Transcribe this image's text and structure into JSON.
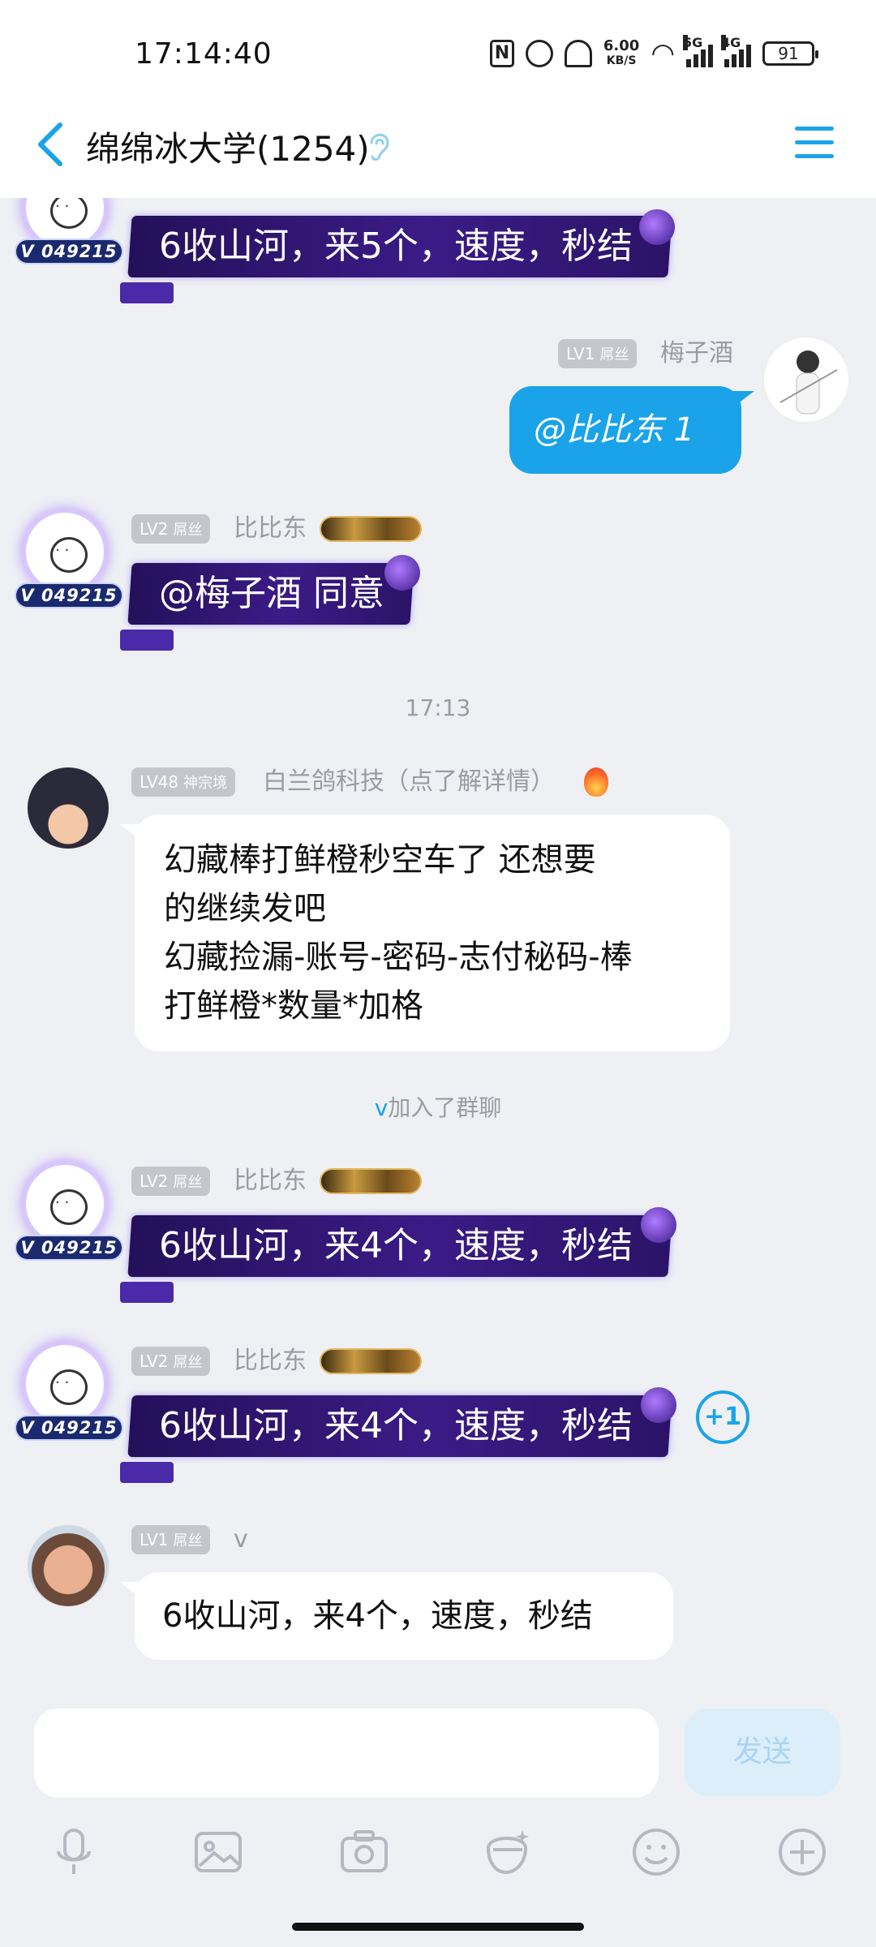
{
  "status": {
    "time": "17:14:40",
    "speed_top": "6.00",
    "speed_unit": "KB/S",
    "net1": "5G",
    "net2": "4G",
    "battery": "91"
  },
  "header": {
    "title": "绵绵冰大学(1254)"
  },
  "messages": {
    "m1": {
      "vbadge": "V 049215",
      "text": "6收山河，来5个，速度，秒结"
    },
    "m2": {
      "level": "LV1",
      "rank": "屌丝",
      "sender": "梅子酒",
      "text": "@比比东 1"
    },
    "m3": {
      "level": "LV2",
      "rank": "屌丝",
      "sender": "比比东",
      "vbadge": "V 049215",
      "text": "@梅子酒 同意"
    },
    "timestamp": "17:13",
    "m4": {
      "level": "LV48",
      "rank": "神宗境",
      "sender": "白兰鸽科技（点了解详情）",
      "lines": [
        "幻藏棒打鲜橙秒空车了  还想要",
        "的继续发吧",
        "幻藏捡漏-账号-密码-志付秘码-棒",
        "打鲜橙*数量*加格"
      ]
    },
    "system": {
      "name": "v",
      "text": "加入了群聊"
    },
    "m5": {
      "level": "LV2",
      "rank": "屌丝",
      "sender": "比比东",
      "vbadge": "V 049215",
      "text": "6收山河，来4个，速度，秒结"
    },
    "m6": {
      "level": "LV2",
      "rank": "屌丝",
      "sender": "比比东",
      "vbadge": "V 049215",
      "text": "6收山河，来4个，速度，秒结"
    },
    "m7": {
      "level": "LV1",
      "rank": "屌丝",
      "sender": "v",
      "text": "6收山河，来4个，速度，秒结",
      "plus": "+1"
    }
  },
  "input": {
    "placeholder": "",
    "send_label": "发送"
  },
  "toolbar": [
    "mic-icon",
    "image-icon",
    "camera-icon",
    "sticker-icon",
    "emoji-icon",
    "plus-icon"
  ],
  "colors": {
    "accent": "#1aa3e8",
    "bg": "#eef0f4",
    "dark_bubble": "#2b1468"
  }
}
